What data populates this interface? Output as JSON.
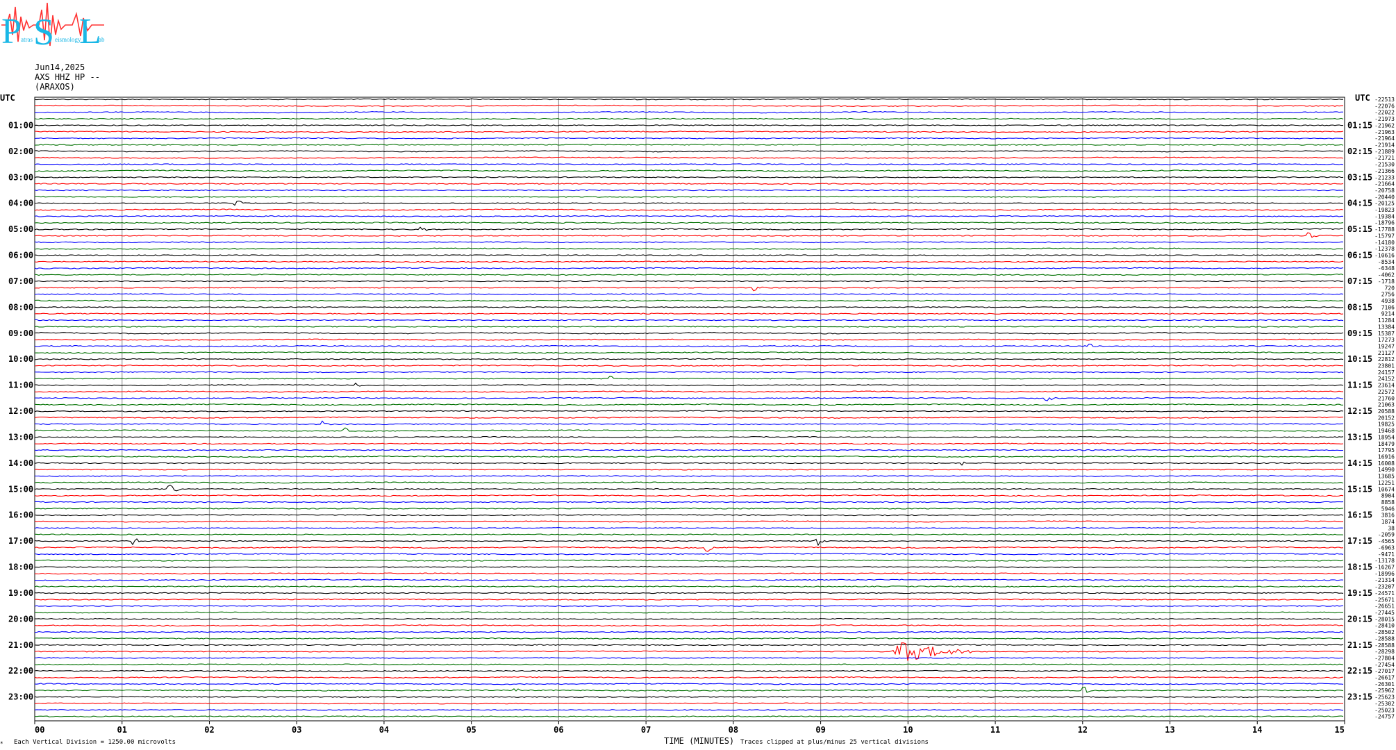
{
  "logo": {
    "letters": [
      "P",
      "S",
      "L"
    ],
    "words": [
      "atras",
      "eismology",
      "ab"
    ]
  },
  "header": {
    "date": "Jun14,2025",
    "channel": "AXS HHZ HP --",
    "station": "(ARAXOS)"
  },
  "footer": {
    "corner_mark": "∗",
    "scale_note": "Each Vertical Division = 1250.00 microvolts",
    "xlabel": "TIME (MINUTES)",
    "clip_note": "Traces clipped at plus/minus 25 vertical divisions"
  },
  "chart_data": {
    "type": "line",
    "title": "",
    "xlabel": "TIME (MINUTES)",
    "xlim": [
      0,
      15
    ],
    "x_ticks": [
      "00",
      "01",
      "02",
      "03",
      "04",
      "05",
      "06",
      "07",
      "08",
      "09",
      "10",
      "11",
      "12",
      "13",
      "14",
      "15"
    ],
    "y_axis_label_left": "UTC",
    "y_axis_label_right": "UTC",
    "hour_labels_left": [
      "01:00",
      "02:00",
      "03:00",
      "04:00",
      "05:00",
      "06:00",
      "07:00",
      "08:00",
      "09:00",
      "10:00",
      "11:00",
      "12:00",
      "13:00",
      "14:00",
      "15:00",
      "16:00",
      "17:00",
      "18:00",
      "19:00",
      "20:00",
      "21:00",
      "22:00",
      "23:00"
    ],
    "hour_labels_right": [
      "01:15",
      "02:15",
      "03:15",
      "04:15",
      "05:15",
      "06:15",
      "07:15",
      "08:15",
      "09:15",
      "10:15",
      "11:15",
      "12:15",
      "13:15",
      "14:15",
      "15:15",
      "16:15",
      "17:15",
      "18:15",
      "19:15",
      "20:15",
      "21:15",
      "22:15",
      "23:15"
    ],
    "trace_minutes": 15,
    "trace_count": 96,
    "trace_color_cycle": [
      "#000000",
      "#ff0000",
      "#0000ff",
      "#007000"
    ],
    "trace_offsets": [
      "-22513",
      "-22076",
      "-22022",
      "-21973",
      "-21962",
      "-21963",
      "-21964",
      "-21914",
      "-21889",
      "-21721",
      "-21530",
      "-21366",
      "-21233",
      "-21664",
      "-20758",
      "-20440",
      "-20125",
      "-19823",
      "-19384",
      "-18796",
      "-17788",
      "-15797",
      "-14180",
      "-12378",
      "-10616",
      "-8534",
      "-6348",
      "-4062",
      "-1718",
      "720",
      "2756",
      "4938",
      "7106",
      "9214",
      "11284",
      "13384",
      "15387",
      "17273",
      "19247",
      "21127",
      "22812",
      "23801",
      "24157",
      "24152",
      "23614",
      "22572",
      "21760",
      "21063",
      "20588",
      "20152",
      "19825",
      "19468",
      "18954",
      "18479",
      "17795",
      "16916",
      "16008",
      "14990",
      "13685",
      "12251",
      "10674",
      "8904",
      "8858",
      "5946",
      "3816",
      "1874",
      "38",
      "-2059",
      "-4565",
      "-6963",
      "-9471",
      "-13178",
      "-16267",
      "-18996",
      "-21314",
      "-23207",
      "-24571",
      "-25671",
      "-26651",
      "-27445",
      "-28015",
      "-28410",
      "-28502",
      "-28588",
      "-28588",
      "-28298",
      "-27804",
      "-27454",
      "-27017",
      "-26617",
      "-26301",
      "-25962",
      "-25623",
      "-25302",
      "-25023",
      "-24757"
    ],
    "events": [
      {
        "trace": 16,
        "minute": 2.3,
        "amplitude": 0.5
      },
      {
        "trace": 20,
        "minute": 4.4,
        "amplitude": 0.4
      },
      {
        "trace": 21,
        "minute": 14.6,
        "amplitude": 0.5
      },
      {
        "trace": 29,
        "minute": 8.25,
        "amplitude": 0.7
      },
      {
        "trace": 38,
        "minute": 12.1,
        "amplitude": 0.3
      },
      {
        "trace": 43,
        "minute": 6.6,
        "amplitude": 0.3
      },
      {
        "trace": 44,
        "minute": 3.7,
        "amplitude": 0.3
      },
      {
        "trace": 46,
        "minute": 11.6,
        "amplitude": 0.4
      },
      {
        "trace": 50,
        "minute": 3.3,
        "amplitude": 0.6
      },
      {
        "trace": 51,
        "minute": 3.55,
        "amplitude": 0.4
      },
      {
        "trace": 56,
        "minute": 10.6,
        "amplitude": 0.4
      },
      {
        "trace": 60,
        "minute": 1.55,
        "amplitude": 0.8
      },
      {
        "trace": 68,
        "minute": 8.95,
        "amplitude": 0.9
      },
      {
        "trace": 68,
        "minute": 1.15,
        "amplitude": 0.5
      },
      {
        "trace": 69,
        "minute": 7.7,
        "amplitude": 0.6
      },
      {
        "trace": 85,
        "minute": 9.85,
        "amplitude": 1.7,
        "duration": 0.9
      },
      {
        "trace": 91,
        "minute": 12.0,
        "amplitude": 0.8
      },
      {
        "trace": 91,
        "minute": 5.5,
        "amplitude": 0.3
      }
    ]
  }
}
